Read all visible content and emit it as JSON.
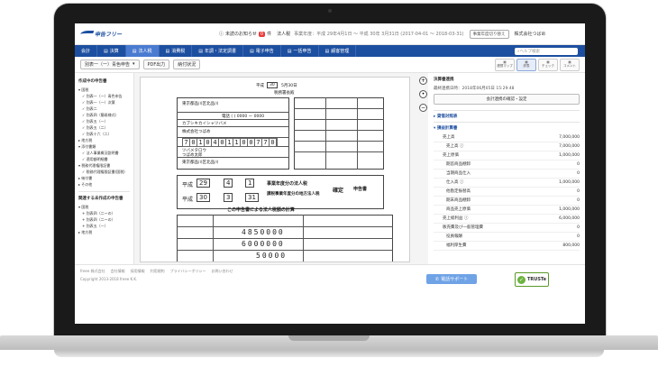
{
  "header": {
    "logo_text": "申告フリー",
    "notice_label": "未読のお知らせ",
    "notice_count": "0",
    "notice_unit": "件",
    "corp_type": "法人税",
    "period": "事業年度：平成 29年4月1日 〜 平成 30年 3月31日 (2017-04-01 〜 2018-03-31)",
    "switch_period_label": "事業年度切り替え",
    "company": "株式会社つばめ"
  },
  "nav": {
    "items": [
      {
        "label": "会計",
        "icon": ""
      },
      {
        "label": "決算",
        "icon": "▤"
      },
      {
        "label": "法人税",
        "icon": "▤"
      },
      {
        "label": "消費税",
        "icon": "▤"
      },
      {
        "label": "年調・法定調書",
        "icon": "▤"
      },
      {
        "label": "電子申告",
        "icon": "▤"
      },
      {
        "label": "一括申告",
        "icon": "▤"
      },
      {
        "label": "顧客管理",
        "icon": "▤"
      }
    ],
    "help_placeholder": "ヘルプ検索"
  },
  "subbar": {
    "form_select": "別表一（一）青色申告",
    "pdf_label": "PDF出力",
    "status_label": "納付状況",
    "toolbar": [
      {
        "label": "連想マップ"
      },
      {
        "label": "詳表"
      },
      {
        "label": "チェック"
      },
      {
        "label": "コメント"
      }
    ]
  },
  "left": {
    "section1_title": "作成中の申告書",
    "items1": [
      {
        "label": "▾ 国税",
        "lvl": 0
      },
      {
        "label": "✓ 別表一（一）青色申告",
        "lvl": 1
      },
      {
        "label": "✓ 別表一（一）次葉",
        "lvl": 1
      },
      {
        "label": "✓ 別表二",
        "lvl": 1
      },
      {
        "label": "✓ 別表四（簡易様式）",
        "lvl": 1
      },
      {
        "label": "✓ 別表五（一）",
        "lvl": 1
      },
      {
        "label": "✓ 別表五（二）",
        "lvl": 1
      },
      {
        "label": "✓ 別表十六（二）",
        "lvl": 1
      },
      {
        "label": "▸ 地方税",
        "lvl": 0
      },
      {
        "label": "▾ 添付書類",
        "lvl": 0
      },
      {
        "label": "✓ 法人事業概況説明書",
        "lvl": 1
      },
      {
        "label": "✓ 適用額明細書",
        "lvl": 1
      },
      {
        "label": "▾ 税務代理権限証書",
        "lvl": 0
      },
      {
        "label": "✓ 税務代理権限証書(国税)",
        "lvl": 1
      },
      {
        "label": "▸ 納付書",
        "lvl": 0
      },
      {
        "label": "▸ その他",
        "lvl": 0
      }
    ],
    "section2_title": "関連する未作成の申告書",
    "items2": [
      {
        "label": "▾ 国税",
        "lvl": 0
      },
      {
        "label": "+ 別表四（二ーの）",
        "lvl": 1
      },
      {
        "label": "+ 別表四（二ーの）",
        "lvl": 1
      },
      {
        "label": "+ 別表五（一）",
        "lvl": 1
      },
      {
        "label": "▸ 地方税",
        "lvl": 0
      }
    ]
  },
  "doc": {
    "era1": "平成",
    "year_box": "30",
    "date_text": "5月30日",
    "office": "税務署長殿",
    "address": "東京都品川区北品川",
    "phone": "電話 (   )    0000 ー 0000",
    "kana": "カブシキカイシャツバメ",
    "corp_name": "株式会社つばめ",
    "corp_number": "7010401100770",
    "rep_kana": "ツバメタロウ",
    "rep_name": "つばめ太郎",
    "rep_addr": "東京都品川区北品川",
    "from_era": "平成",
    "from_y": "29",
    "from_m": "4",
    "from_d": "1",
    "to_era": "平成",
    "to_y": "30",
    "to_m": "3",
    "to_d": "31",
    "title1": "事業年度分の法人税",
    "title2": "課税事業年度分の地方法人税",
    "kind": "確定",
    "suffix": "申告書",
    "amount1": "4850000",
    "amount2": "6000000",
    "amount3": "50000",
    "section_label": "この申告書による法人税額の計算"
  },
  "right": {
    "title": "決算書連携",
    "last_date": "最終連携日時：2018年06月05日 15:29:48",
    "confirm_btn": "会計連携の確認・設定",
    "sec1": "貸借対照表",
    "sec2": "損益計算書",
    "rows": [
      {
        "label": "売上高",
        "value": "7,000,000",
        "lvl": 1
      },
      {
        "label": "売上高 ⓘ",
        "value": "7,000,000",
        "lvl": 2
      },
      {
        "label": "売上原価",
        "value": "1,000,000",
        "lvl": 1
      },
      {
        "label": "期首商品棚卸",
        "value": "0",
        "lvl": 2
      },
      {
        "label": "当期商品仕入",
        "value": "0",
        "lvl": 2
      },
      {
        "label": "仕入高 ⓘ",
        "value": "1,000,000",
        "lvl": 2
      },
      {
        "label": "他勘定振替高",
        "value": "0",
        "lvl": 2
      },
      {
        "label": "期末商品棚卸",
        "value": "0",
        "lvl": 2
      },
      {
        "label": "商品売上原価",
        "value": "1,000,000",
        "lvl": 2
      },
      {
        "label": "売上総利益 ⓘ",
        "value": "6,000,000",
        "lvl": 1
      },
      {
        "label": "販売費及び一般管理費",
        "value": "0",
        "lvl": 1
      },
      {
        "label": "役員報酬",
        "value": "0",
        "lvl": 2
      },
      {
        "label": "福利厚生費",
        "value": "800,000",
        "lvl": 2
      }
    ]
  },
  "footer": {
    "links": [
      "freee 株式会社",
      "会社情報",
      "採用情報",
      "利用規約",
      "プライバシーポリシー",
      "お問い合わせ"
    ],
    "copyright": "Copyright 2013-2018 freee K.K.",
    "support_label": "電話サポート",
    "truste_label": "TRUSTe"
  },
  "colors": {
    "brand": "#1d4fa0",
    "nav_active": "#4a7bd1",
    "badge": "#e83a3a",
    "support": "#6fa3e6"
  }
}
